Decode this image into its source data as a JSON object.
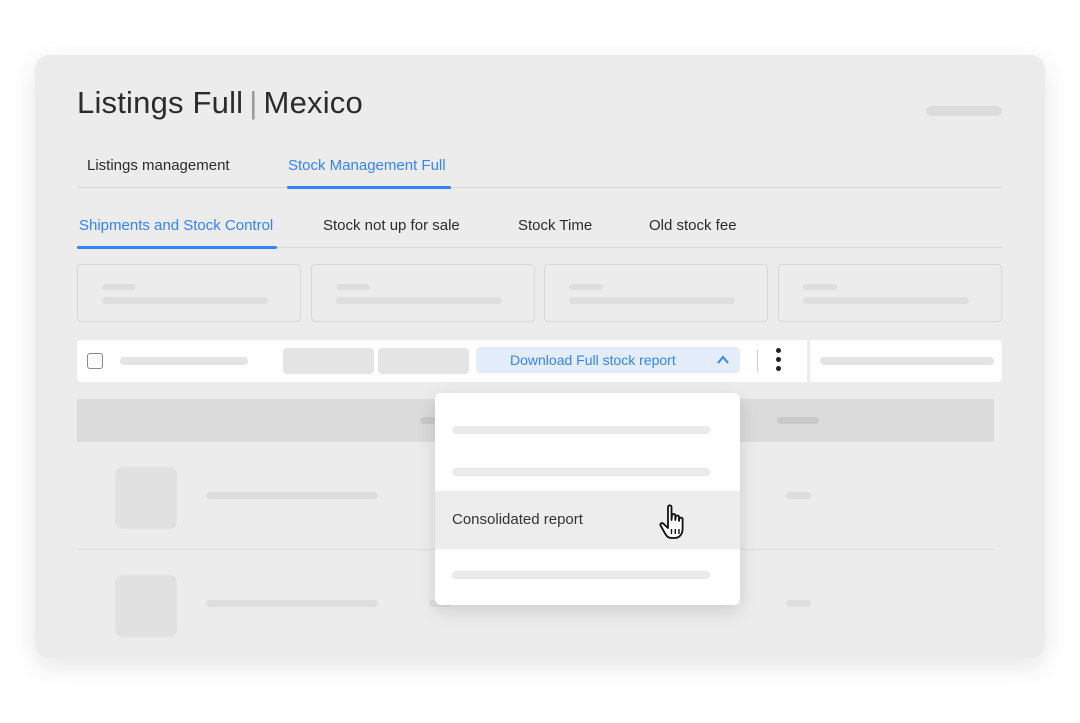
{
  "header": {
    "title_primary": "Listings Full",
    "title_separator": "|",
    "title_secondary": "Mexico"
  },
  "main_tabs": [
    {
      "label": "Listings management",
      "active": false
    },
    {
      "label": "Stock Management Full",
      "active": true
    }
  ],
  "sub_tabs": [
    {
      "label": "Shipments and Stock Control",
      "active": true
    },
    {
      "label": "Stock not up for sale",
      "active": false
    },
    {
      "label": "Stock Time",
      "active": false
    },
    {
      "label": "Old stock fee",
      "active": false
    }
  ],
  "toolbar": {
    "download_label": "Download Full stock report",
    "download_icon": "chevron-up-icon",
    "more_icon": "kebab-menu-icon"
  },
  "dropdown": {
    "items": [
      {
        "label": "",
        "placeholder": true
      },
      {
        "label": "",
        "placeholder": true
      },
      {
        "label": "Consolidated report",
        "placeholder": false,
        "hovered": true
      },
      {
        "label": "",
        "placeholder": true
      }
    ]
  },
  "colors": {
    "accent": "#3483fa",
    "accent_bg": "#e3edfb",
    "card_bg": "#ececec"
  },
  "cursor_icon": "hand-pointer-icon"
}
